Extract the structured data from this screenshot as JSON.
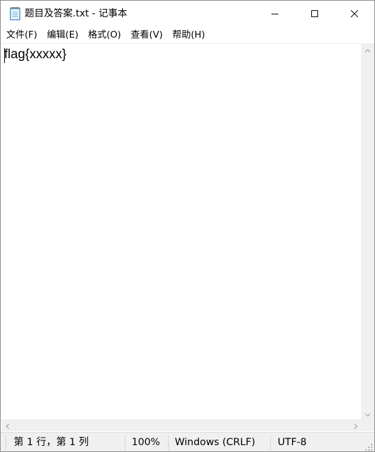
{
  "window": {
    "title": "题目及答案.txt - 记事本",
    "app_icon": "notepad-icon",
    "controls": {
      "minimize_icon": "minimize-icon",
      "maximize_icon": "maximize-icon",
      "close_icon": "close-icon"
    }
  },
  "menu": {
    "items": [
      {
        "label": "文件(F)"
      },
      {
        "label": "编辑(E)"
      },
      {
        "label": "格式(O)"
      },
      {
        "label": "查看(V)"
      },
      {
        "label": "帮助(H)"
      }
    ]
  },
  "editor": {
    "text": "flag{xxxxx}"
  },
  "status": {
    "position": "第 1 行，第 1 列",
    "zoom": "100%",
    "line_ending": "Windows (CRLF)",
    "encoding": "UTF-8"
  },
  "colors": {
    "chrome_background": "#f0f0f0",
    "editor_background": "#ffffff",
    "text": "#000000"
  }
}
